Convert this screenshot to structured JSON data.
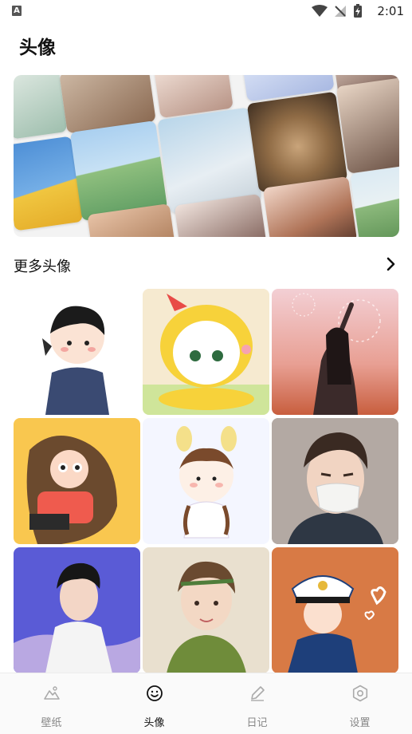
{
  "status_bar": {
    "app_badge": "A",
    "time": "2:01",
    "icons": [
      "wifi-icon",
      "no-signal-icon",
      "battery-charging-icon"
    ]
  },
  "page": {
    "title": "头像"
  },
  "more_section": {
    "title": "更多头像",
    "more_icon": "chevron-right-icon"
  },
  "tab_bar": {
    "items": [
      {
        "label": "壁纸",
        "icon": "wallpaper-icon",
        "active": false
      },
      {
        "label": "头像",
        "icon": "smile-icon",
        "active": true
      },
      {
        "label": "日记",
        "icon": "pencil-icon",
        "active": false
      },
      {
        "label": "设置",
        "icon": "settings-icon",
        "active": false
      }
    ]
  },
  "colors": {
    "tab_active": "#111111",
    "tab_inactive": "#888888"
  }
}
